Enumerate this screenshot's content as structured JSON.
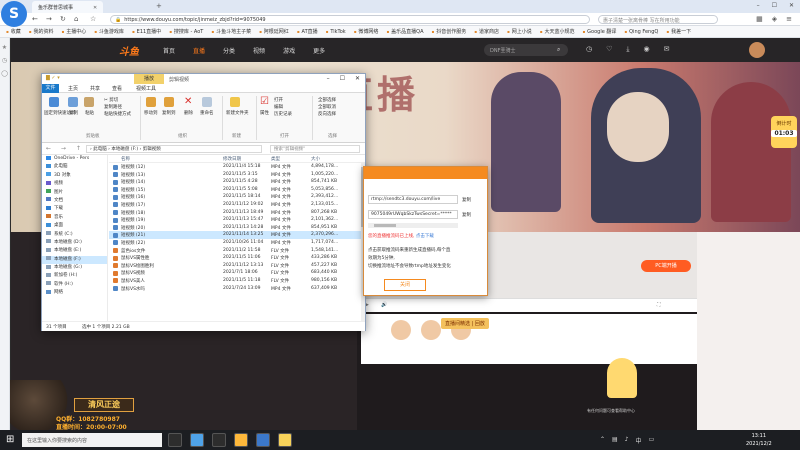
{
  "browser": {
    "tab_title": "鱼乐群普思城事",
    "url": "https://www.douyu.com/topic/jinmeiz_zbjd?rid=9075049",
    "search_placeholder": "惠子清楚一张离骨棒 写在所用功能",
    "bookmarks": [
      "收藏",
      "我的资料",
      "主播中心",
      "斗鱼游戏库",
      "E11直播中",
      "搜搜库 - AoT",
      "斗鱼斗地主子菜",
      "阿根廷网红",
      "AT直播",
      "TikTok",
      "微博网络",
      "盖乐品直播QA",
      "抖音创作服务",
      "道家商店",
      "网上小说",
      "大天蓝小规范",
      "Google 翻译",
      "Qing FengQ",
      "我差一下"
    ]
  },
  "douyu": {
    "logo": "斗鱼",
    "nav": [
      "首页",
      "直播",
      "分类",
      "视频",
      "游戏",
      "更多"
    ],
    "search_placeholder": "DNF圣骑士",
    "banner_title": "甜美直播",
    "rank_label": "倒计时",
    "rank_time": "01:03",
    "pc_button": "PC端开播",
    "gift_label": "直播间精选",
    "tag_label": "回放",
    "footer_text": "有任何问题可查看帮助中心"
  },
  "explorer": {
    "quick_access": "▾",
    "context_tab": "播放",
    "window_title": "剪辑视频",
    "tabs": [
      "文件",
      "主页",
      "共享",
      "查看",
      "视频工具"
    ],
    "ribbon": {
      "pin": "固定到快速访问",
      "copy": "复制",
      "paste": "粘贴",
      "cut": "剪切",
      "copy_path": "复制路径",
      "paste_shortcut": "粘贴快捷方式",
      "move_to": "移动到",
      "copy_to": "复制到",
      "delete": "删除",
      "rename": "重命名",
      "new_folder": "新建文件夹",
      "properties": "属性",
      "open": "打开",
      "edit": "编辑",
      "history": "历史记录",
      "select_all": "全部选择",
      "select_none": "全部取消",
      "invert": "反向选择",
      "group_clipboard": "剪贴板",
      "group_organize": "组织",
      "group_new": "新建",
      "group_open": "打开",
      "group_select": "选择"
    },
    "address": "› 此电脑 › 本地磁盘 (F:) › 剪辑视频",
    "search_placeholder": "搜索\"剪辑视频\"",
    "nav_items": [
      {
        "label": "OneDrive - Pers",
        "icon": "#2d8ae8"
      },
      {
        "label": "此电脑",
        "icon": "#3b8fd9"
      },
      {
        "label": "3D 对象",
        "icon": "#4aa0e6"
      },
      {
        "label": "视频",
        "icon": "#6a5acd"
      },
      {
        "label": "图片",
        "icon": "#3fa55a"
      },
      {
        "label": "文档",
        "icon": "#5277c1"
      },
      {
        "label": "下载",
        "icon": "#2f7fd2"
      },
      {
        "label": "音乐",
        "icon": "#d2752f"
      },
      {
        "label": "桌面",
        "icon": "#3b8fd9"
      },
      {
        "label": "系统 (C:)",
        "icon": "#8aa0b8"
      },
      {
        "label": "本地磁盘 (D:)",
        "icon": "#8aa0b8"
      },
      {
        "label": "本地磁盘 (E:)",
        "icon": "#8aa0b8"
      },
      {
        "label": "本地磁盘 (F:)",
        "icon": "#8aa0b8"
      },
      {
        "label": "本地磁盘 (G:)",
        "icon": "#8aa0b8"
      },
      {
        "label": "新加卷 (H:)",
        "icon": "#8aa0b8"
      },
      {
        "label": "软件 (H:)",
        "icon": "#8aa0b8"
      },
      {
        "label": "网络",
        "icon": "#5a8fc9"
      }
    ],
    "nav_selected_index": 12,
    "columns": [
      "名称",
      "修改日期",
      "类型",
      "大小"
    ],
    "files": [
      {
        "name": "短视频 (12)",
        "date": "2021/11/4 15:18",
        "type": "MP4 文件",
        "size": "4,894,178..."
      },
      {
        "name": "短视频 (13)",
        "date": "2021/11/5 3:15",
        "type": "MP4 文件",
        "size": "1,005,220..."
      },
      {
        "name": "短视频 (14)",
        "date": "2021/11/5 4:28",
        "type": "MP4 文件",
        "size": "854,741 KB"
      },
      {
        "name": "短视频 (15)",
        "date": "2021/11/5 5:08",
        "type": "MP4 文件",
        "size": "5,053,856..."
      },
      {
        "name": "短视频 (16)",
        "date": "2021/11/5 18:14",
        "type": "MP4 文件",
        "size": "2,393,412..."
      },
      {
        "name": "短视频 (17)",
        "date": "2021/11/12 19:02",
        "type": "MP4 文件",
        "size": "2,133,015..."
      },
      {
        "name": "短视频 (18)",
        "date": "2021/11/13 18:49",
        "type": "MP4 文件",
        "size": "807,268 KB"
      },
      {
        "name": "短视频 (19)",
        "date": "2021/11/13 15:47",
        "type": "MP4 文件",
        "size": "2,101,362..."
      },
      {
        "name": "短视频 (20)",
        "date": "2021/11/13 14:28",
        "type": "MP4 文件",
        "size": "854,951 KB"
      },
      {
        "name": "短视频 (21)",
        "date": "2021/11/14 13:25",
        "type": "MP4 文件",
        "size": "2,370,296..."
      },
      {
        "name": "短视频 (22)",
        "date": "2021/10/26 11:04",
        "type": "MP4 文件",
        "size": "1,717,074..."
      },
      {
        "name": "蓝色ios文件",
        "date": "2021/11/2 11:58",
        "type": "FLV 文件",
        "size": "1,548,141..."
      },
      {
        "name": "鼠标VS属性胜",
        "date": "2021/11/5 11:06",
        "type": "FLV 文件",
        "size": "433,286 KB"
      },
      {
        "name": "鼠标VS绘图胜利",
        "date": "2021/11/12 13:13",
        "type": "FLV 文件",
        "size": "457,227 KB"
      },
      {
        "name": "鼠标VS视频",
        "date": "2021/7/1 18:06",
        "type": "FLV 文件",
        "size": "683,440 KB"
      },
      {
        "name": "鼠标VS美人",
        "date": "2021/11/5 11:18",
        "type": "FLV 文件",
        "size": "980,156 KB"
      },
      {
        "name": "鼠标VS水吗",
        "date": "2021/7/24 13:09",
        "type": "MP4 文件",
        "size": "637,409 KB"
      }
    ],
    "selected_file_index": 9,
    "mp4_icon_color": "#4f86c6",
    "flv_icon_color": "#e07a2e",
    "status_count": "31 个项目",
    "status_selected": "选中 1 个项目  2.21 GB"
  },
  "dialog": {
    "rtmp_url": "rtmp://sendtc3.douyu.com/live",
    "stream_key": "9075049rUWqbSkzTwsSecret=*****",
    "copy_label": "复制",
    "notice_red": "您的直播推流码已上线,",
    "notice_blue": "点击下载",
    "info_lines": [
      "点击获取推流码来重新生成直播码,每个直",
      "效期为5分钟,",
      "切换推流地址不会导致rtmp地址发生变化"
    ],
    "close_label": "关闭"
  },
  "overlay": {
    "name": "清风正途",
    "line1": "QQ群：1082780987",
    "line2": "直播时间：20:00-07:00"
  },
  "taskbar": {
    "search_placeholder": "在这里输入你要搜索的内容",
    "time": "13:11",
    "date": "2021/12/2",
    "app_colors": [
      "#2d2d2d",
      "#4fa3e8",
      "#2d2d2d",
      "#fdb83b",
      "#3b78c9",
      "#f6d25a"
    ]
  }
}
